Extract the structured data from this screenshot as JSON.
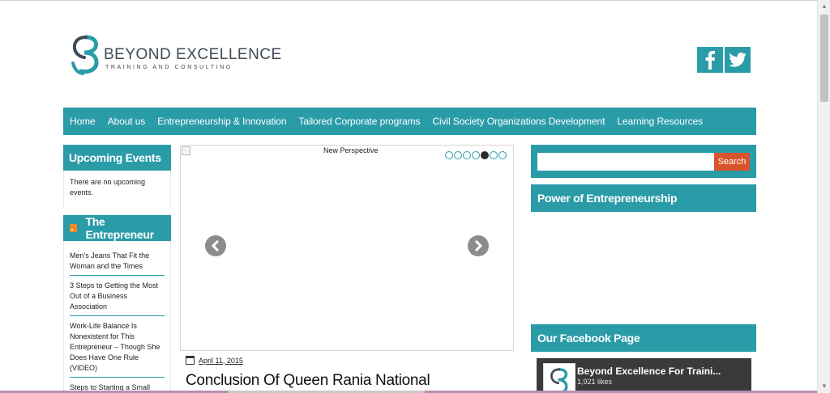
{
  "header": {
    "logo_name": "BEYOND EXCELLENCE",
    "logo_tagline": "TRAINING AND CONSULTING",
    "social_facebook_icon": "facebook-icon",
    "social_twitter_icon": "twitter-icon"
  },
  "nav": {
    "items": [
      {
        "label": "Home"
      },
      {
        "label": "About us"
      },
      {
        "label": "Entrepreneurship & Innovation"
      },
      {
        "label": "Tailored Corporate programs"
      },
      {
        "label": "Civil Society Organizations Development"
      },
      {
        "label": "Learning Resources"
      }
    ]
  },
  "left_sidebar": {
    "events_title": "Upcoming Events",
    "events_text": "There are no upcoming events.",
    "entrepreneur_title": "The Entrepreneur",
    "feed": [
      {
        "title": "Men's Jeans That Fit the Woman and the Times"
      },
      {
        "title": "3 Steps to Getting the Most Out of a Business Association"
      },
      {
        "title": "Work-Life Balance Is Nonexistent for This Entrepreneur – Though She Does Have One Rule (VIDEO)"
      },
      {
        "title": "Steps to Starting a Small"
      }
    ]
  },
  "slider": {
    "caption": "New Perspective",
    "dot_count": 7,
    "active_dot": 5
  },
  "post": {
    "date": "April 11, 2015",
    "title": "Conclusion Of Queen Rania National"
  },
  "right_sidebar": {
    "search_placeholder": "",
    "search_button": "Search",
    "power_title": "Power of Entrepreneurship",
    "facebook_title": "Our Facebook Page",
    "fb_page_name": "Beyond Excellence For Traini...",
    "fb_likes": "1,921 likes"
  },
  "colors": {
    "accent": "#2a9ca8",
    "search_button": "#d9532c",
    "rss": "#f08a24"
  }
}
